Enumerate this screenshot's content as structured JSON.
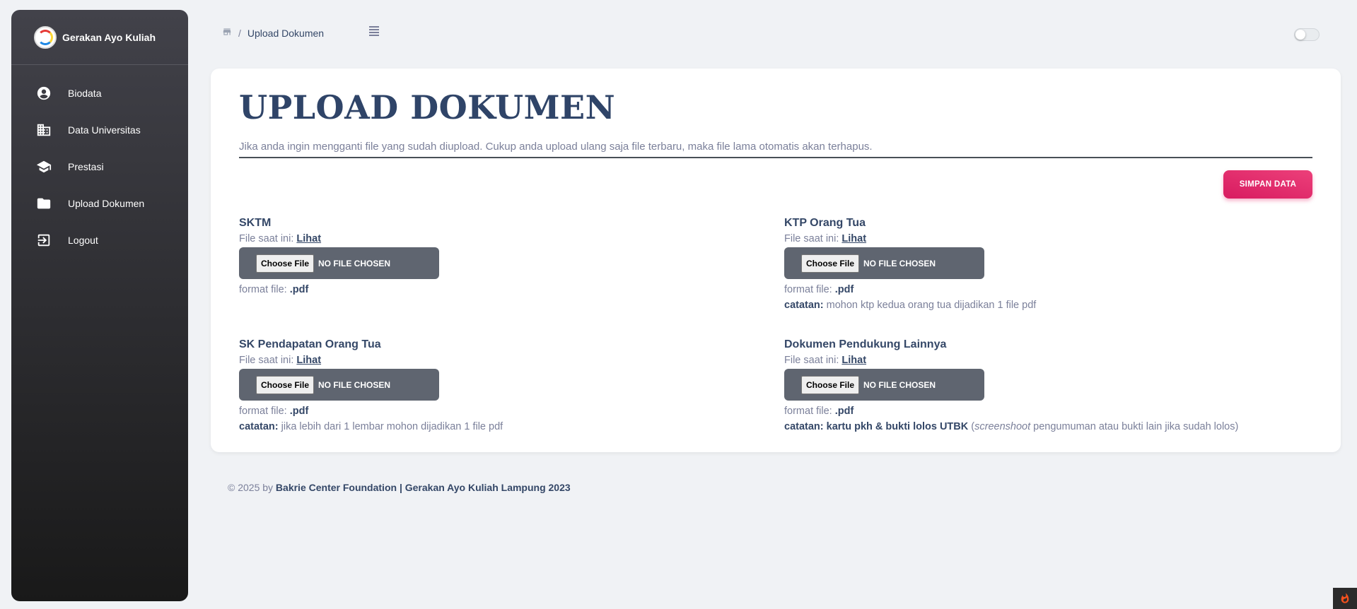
{
  "sidebar": {
    "brand": "Gerakan Ayo Kuliah",
    "items": [
      {
        "label": "Biodata",
        "icon": "account-circle-icon"
      },
      {
        "label": "Data Universitas",
        "icon": "building-icon"
      },
      {
        "label": "Prestasi",
        "icon": "graduation-cap-icon"
      },
      {
        "label": "Upload Dokumen",
        "icon": "folder-icon"
      },
      {
        "label": "Logout",
        "icon": "logout-icon"
      }
    ]
  },
  "breadcrumb": {
    "separator": "/",
    "current": "Upload Dokumen"
  },
  "card": {
    "title": "UPLOAD DOKUMEN",
    "subtitle": "Jika anda ingin mengganti file yang sudah diupload. Cukup anda upload ulang saja file terbaru, maka file lama otomatis akan terhapus.",
    "save_label": "SIMPAN DATA"
  },
  "fields": [
    {
      "label": "SKTM",
      "current_prefix": "File saat ini:",
      "link": "Lihat",
      "choose": "Choose File",
      "status": "NO FILE CHOSEN",
      "format_prefix": "format file:",
      "format": ".pdf"
    },
    {
      "label": "KTP Orang Tua",
      "current_prefix": "File saat ini:",
      "link": "Lihat",
      "choose": "Choose File",
      "status": "NO FILE CHOSEN",
      "format_prefix": "format file:",
      "format": ".pdf",
      "note_label": "catatan:",
      "note": "mohon ktp kedua orang tua dijadikan 1 file pdf"
    },
    {
      "label": "SK Pendapatan Orang Tua",
      "current_prefix": "File saat ini:",
      "link": "Lihat",
      "choose": "Choose File",
      "status": "NO FILE CHOSEN",
      "format_prefix": "format file:",
      "format": ".pdf",
      "note_label": "catatan:",
      "note": "jika lebih dari 1 lembar mohon dijadikan 1 file pdf"
    },
    {
      "label": "Dokumen Pendukung Lainnya",
      "current_prefix": "File saat ini:",
      "link": "Lihat",
      "choose": "Choose File",
      "status": "NO FILE CHOSEN",
      "format_prefix": "format file:",
      "format": ".pdf",
      "note_label": "catatan: kartu pkh & bukti lolos UTBK",
      "note_open": "(",
      "note_italic": "screenshoot",
      "note": "pengumuman atau bukti lain jika sudah lolos)"
    }
  ],
  "footer": {
    "prefix": "© 2025 by",
    "org": "Bakrie Center Foundation | Gerakan Ayo Kuliah Lampung 2023"
  },
  "colors": {
    "accent": "#d81b60",
    "sidebar_top": "#42424a",
    "sidebar_bottom": "#191919",
    "title": "#2f4468"
  }
}
